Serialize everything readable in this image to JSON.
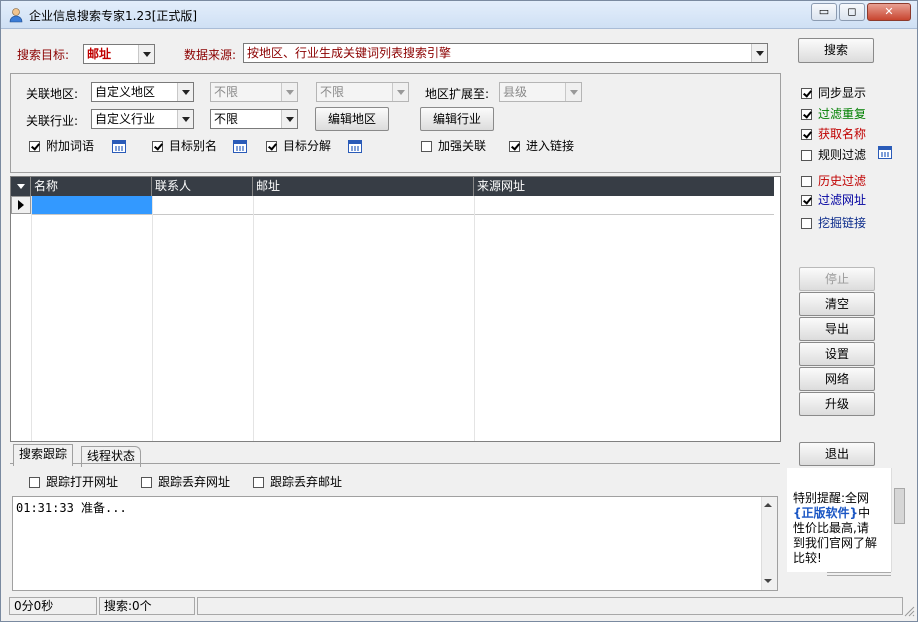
{
  "window": {
    "title": "企业信息搜索专家1.23[正式版]",
    "controls": {
      "minimize": "▭",
      "maximize": "◻",
      "close": "✕"
    }
  },
  "search": {
    "target_label": "搜索目标:",
    "target_value": "邮址",
    "source_label": "数据来源:",
    "source_value": "按地区、行业生成关键词列表搜索引擎",
    "button": "搜索"
  },
  "filters": {
    "region_label": "关联地区:",
    "region_value": "自定义地区",
    "region_sub1": "不限",
    "region_sub2": "不限",
    "expand_label": "地区扩展至:",
    "expand_value": "县级",
    "industry_label": "关联行业:",
    "industry_value": "自定义行业",
    "industry_sub": "不限",
    "edit_region": "编辑地区",
    "edit_industry": "编辑行业",
    "opt_words": "附加词语",
    "opt_alias": "目标别名",
    "opt_split": "目标分解",
    "opt_strengthen": "加强关联",
    "opt_enter_link": "进入链接"
  },
  "options": {
    "sync_display": "同步显示",
    "filter_dup": "过滤重复",
    "get_name": "获取名称",
    "rule_filter": "规则过滤",
    "history_filter": "历史过滤",
    "filter_url": "过滤网址",
    "dig_links": "挖掘链接"
  },
  "colors": {
    "green": "#008000",
    "red": "#c00000",
    "blue": "#0000a0",
    "navy": "#0a2a8a"
  },
  "grid": {
    "columns": [
      "名称",
      "联系人",
      "邮址",
      "来源网址"
    ]
  },
  "actions": {
    "stop": "停止",
    "clear": "清空",
    "export": "导出",
    "settings": "设置",
    "network": "网络",
    "upgrade": "升级",
    "exit": "退出"
  },
  "notice": {
    "line1": "特别提醒:全网",
    "line2_highlight": "{正版软件}",
    "line2_rest": "中",
    "line3": "性价比最高,请",
    "line4": "到我们官网了解",
    "line5": "比较!"
  },
  "tabs": {
    "trace": "搜索跟踪",
    "threads": "线程状态"
  },
  "trace": {
    "open_url": "跟踪打开网址",
    "drop_url": "跟踪丢弃网址",
    "drop_mail": "跟踪丢弃邮址"
  },
  "log": {
    "line1": "01:31:33 准备..."
  },
  "status": {
    "time": "0分0秒",
    "search_count": "搜索:0个"
  }
}
